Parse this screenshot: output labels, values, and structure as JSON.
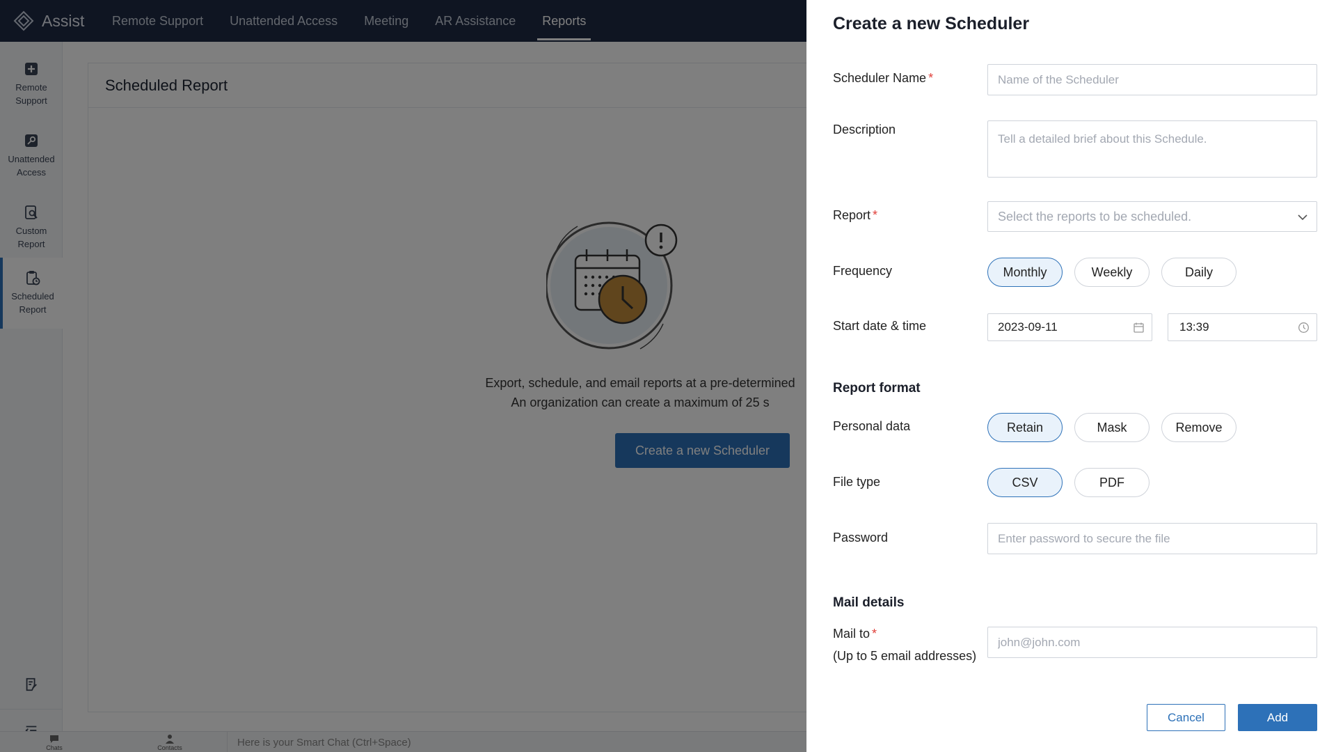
{
  "app": {
    "name": "Assist"
  },
  "nav": {
    "items": [
      {
        "label": "Remote Support"
      },
      {
        "label": "Unattended Access"
      },
      {
        "label": "Meeting"
      },
      {
        "label": "AR Assistance"
      },
      {
        "label": "Reports",
        "active": true
      }
    ]
  },
  "sidebar": {
    "items": [
      {
        "label": "Remote Support",
        "icon": "plus-square-icon"
      },
      {
        "label": "Unattended Access",
        "icon": "key-icon"
      },
      {
        "label": "Custom Report",
        "icon": "report-search-icon"
      },
      {
        "label": "Scheduled Report",
        "icon": "clipboard-clock-icon",
        "active": true
      }
    ],
    "bottom_icons": [
      "notes-icon",
      "collapse-menu-icon"
    ]
  },
  "main": {
    "title": "Scheduled Report",
    "description_line1": "Export, schedule, and email reports at a pre-determined",
    "description_line2": "An organization can create a maximum of 25 s",
    "cta_label": "Create a new Scheduler"
  },
  "chatbar": {
    "chats_label": "Chats",
    "contacts_label": "Contacts",
    "smart_chat_placeholder": "Here is your Smart Chat (Ctrl+Space)"
  },
  "drawer": {
    "title": "Create a new Scheduler",
    "scheduler_name": {
      "label": "Scheduler Name",
      "required": "*",
      "placeholder": "Name of the Scheduler",
      "value": ""
    },
    "description": {
      "label": "Description",
      "placeholder": "Tell a detailed brief about this Schedule.",
      "value": ""
    },
    "report": {
      "label": "Report",
      "required": "*",
      "placeholder": "Select the reports to be scheduled."
    },
    "frequency": {
      "label": "Frequency",
      "options": [
        "Monthly",
        "Weekly",
        "Daily"
      ],
      "selected": "Monthly"
    },
    "start": {
      "label": "Start date & time",
      "date": "2023-09-11",
      "time": "13:39"
    },
    "report_format_title": "Report format",
    "personal_data": {
      "label": "Personal data",
      "options": [
        "Retain",
        "Mask",
        "Remove"
      ],
      "selected": "Retain"
    },
    "file_type": {
      "label": "File type",
      "options": [
        "CSV",
        "PDF"
      ],
      "selected": "CSV"
    },
    "password": {
      "label": "Password",
      "placeholder": "Enter password to secure the file",
      "value": ""
    },
    "mail_details_title": "Mail details",
    "mail_to": {
      "label": "Mail to",
      "required": "*",
      "hint": "(Up to 5 email addresses)",
      "placeholder": "john@john.com",
      "value": ""
    },
    "cancel_label": "Cancel",
    "add_label": "Add"
  },
  "colors": {
    "topbar": "#1f2a44",
    "accent": "#2d71b8",
    "required": "#e0403a",
    "overlay": "rgba(0,0,0,0.5)"
  }
}
